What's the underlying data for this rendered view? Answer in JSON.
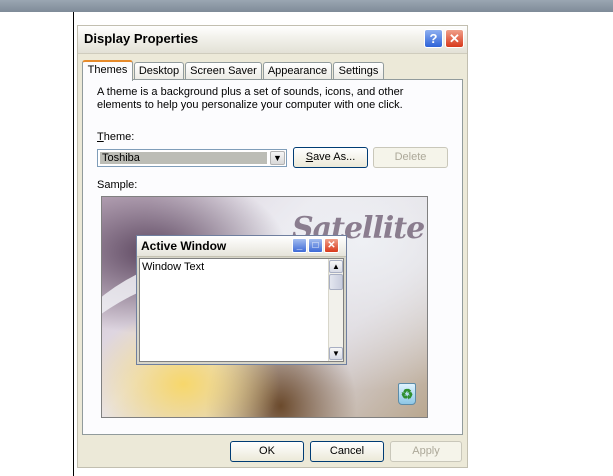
{
  "dialog": {
    "title": "Display Properties",
    "help_label": "?",
    "close_label": "✕"
  },
  "tabs": [
    {
      "label": "Themes"
    },
    {
      "label": "Desktop"
    },
    {
      "label": "Screen Saver"
    },
    {
      "label": "Appearance"
    },
    {
      "label": "Settings"
    }
  ],
  "themes": {
    "description": "A theme is a background plus a set of sounds, icons, and other elements to help you personalize your computer with one click.",
    "theme_label_first": "T",
    "theme_label_rest": "heme:",
    "theme_value": "Toshiba",
    "save_as_first": "S",
    "save_as_rest": "ave As...",
    "delete_label": "Delete",
    "sample_label": "Sample:"
  },
  "sample": {
    "brand_text": "Satellite",
    "active_window_title": "Active Window",
    "window_text": "Window Text"
  },
  "footer": {
    "ok_label": "OK",
    "cancel_label": "Cancel",
    "apply_label": "Apply"
  }
}
